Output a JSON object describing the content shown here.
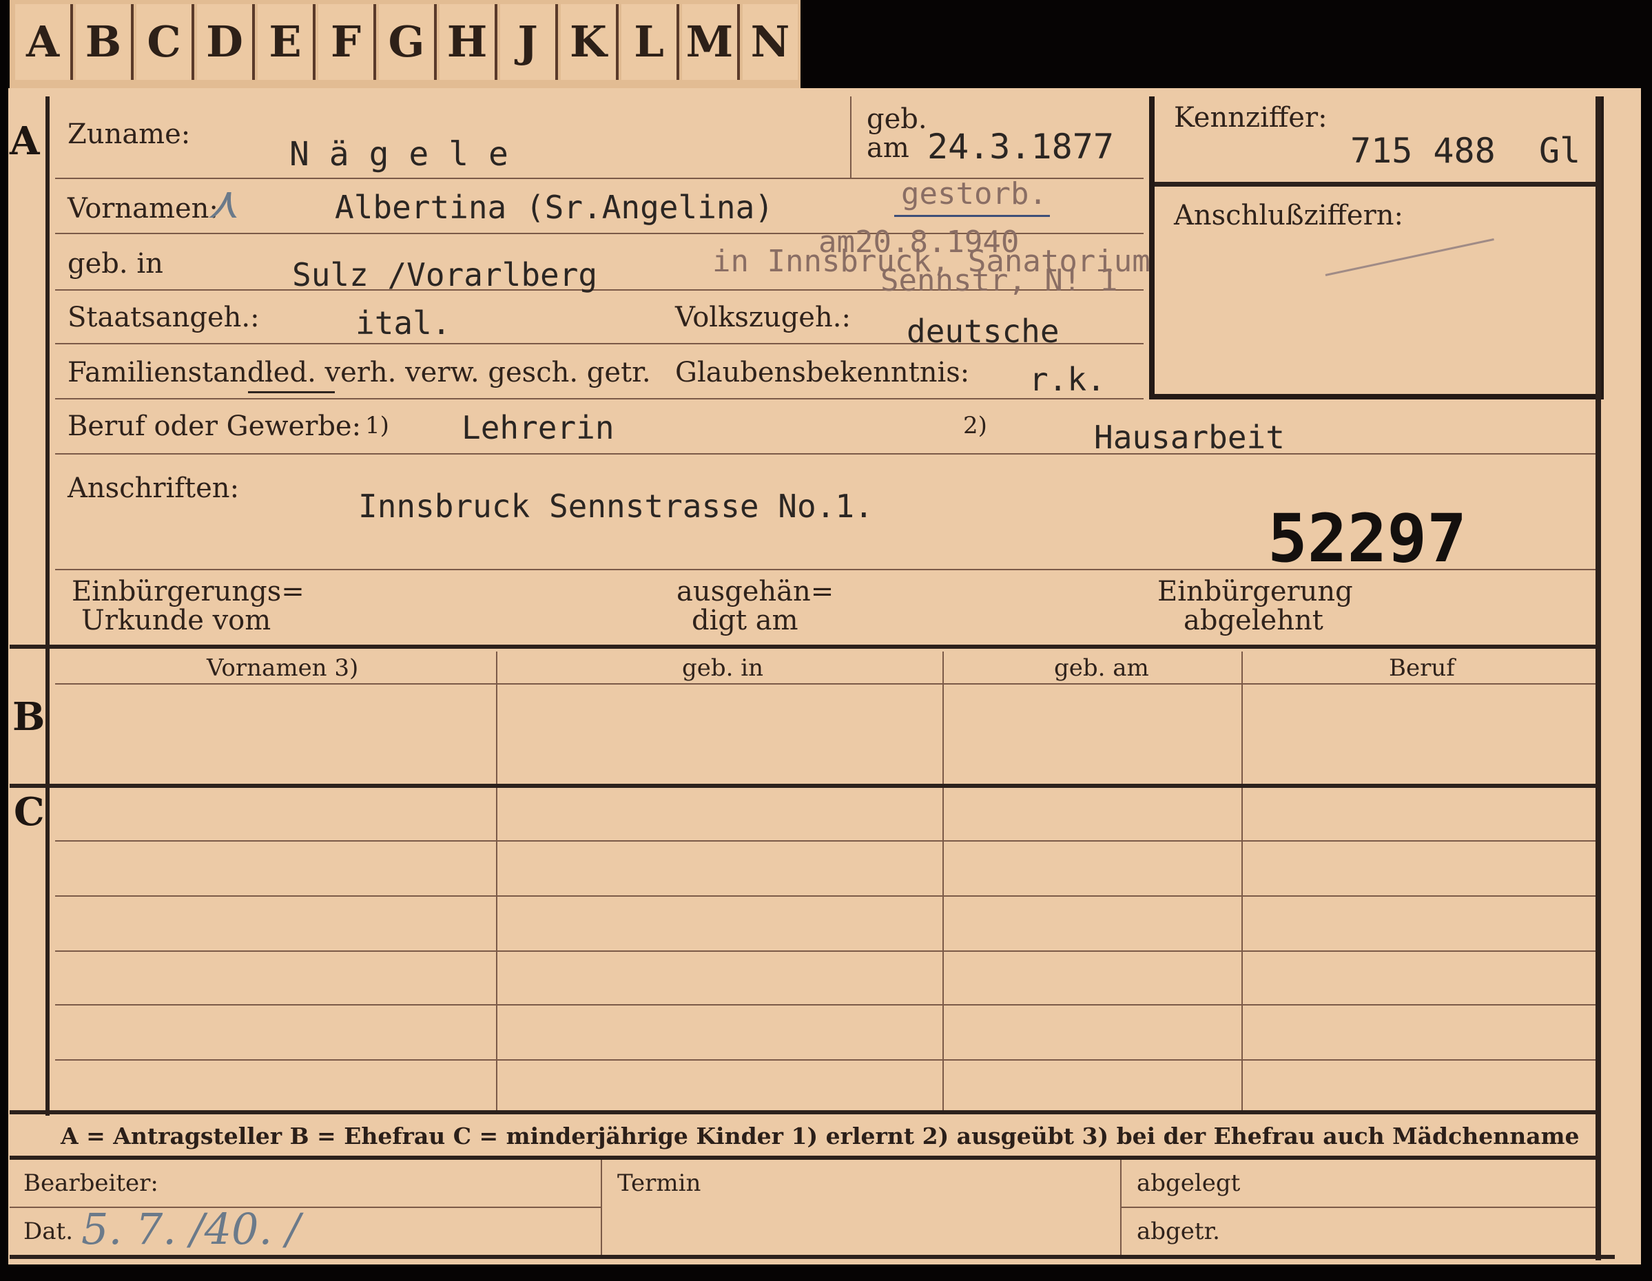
{
  "tabs": [
    "A",
    "B",
    "C",
    "D",
    "E",
    "F",
    "G",
    "H",
    "J",
    "K",
    "L",
    "M",
    "N"
  ],
  "sections": {
    "a": "A",
    "b": "B",
    "c": "C"
  },
  "applicant": {
    "surname_label": "Zuname:",
    "surname": "N ä g e l e",
    "born_label_1": "geb.",
    "born_label_2": "am",
    "born_date": "24.3.1877",
    "given_label": "Vornamen:",
    "given_names": "Albertina (Sr.Angelina)",
    "died_note": "gestorb.",
    "died_date": "am20.8.1940",
    "died_place": "in Innsbruck, Sanatorium",
    "died_street": "Sennstr, N! 1",
    "birthplace_label": "geb. in",
    "birthplace": "Sulz /Vorarlberg",
    "citizenship_label": "Staatsangeh.:",
    "citizenship": "ital.",
    "ethnicity_label": "Volkszugeh.:",
    "ethnicity": "deutsche",
    "marital_label": "Familienstand:",
    "marital_options": "led. verh. verw. gesch. getr.",
    "religion_label": "Glaubensbekenntnis:",
    "religion": "r.k.",
    "occupation_label": "Beruf oder Gewerbe:",
    "occupation_note_1": "1)",
    "occupation_learned": "Lehrerin",
    "occupation_note_2": "2)",
    "occupation_practiced": "Hausarbeit",
    "address_label": "Anschriften:",
    "address": "Innsbruck Sennstrasse No.1.",
    "stamp_number": "52297",
    "naturalization_cert_label_1": "Einbürgerungs=",
    "naturalization_cert_label_2": "Urkunde vom",
    "delivered_label_1": "ausgehän=",
    "delivered_label_2": "digt am",
    "rejected_label_1": "Einbürgerung",
    "rejected_label_2": "abgelehnt"
  },
  "identifiers": {
    "id_label": "Kennziffer:",
    "id_value": "715 488",
    "id_suffix": "Gl",
    "linked_label": "Anschlußziffern:"
  },
  "table": {
    "columns": [
      "Vornamen 3)",
      "geb. in",
      "geb. am",
      "Beruf"
    ]
  },
  "legend": "A = Antragsteller   B = Ehefrau   C = minderjährige Kinder   1) erlernt   2) ausgeübt   3) bei der Ehefrau auch Mädchenname",
  "footer": {
    "clerk_label": "Bearbeiter:",
    "date_label": "Dat.",
    "date_value": "5. 7. /40. /",
    "deadline_label": "Termin",
    "filed_label": "abgelegt",
    "removed_label": "abgetr."
  },
  "colors": {
    "card": "#eccaa6",
    "ink": "#2a1d16",
    "background": "#060404"
  }
}
